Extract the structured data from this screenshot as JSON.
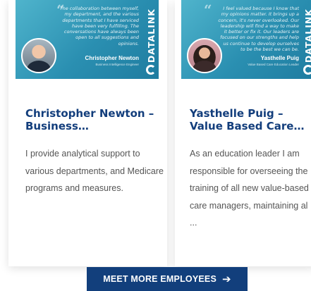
{
  "cards": [
    {
      "quote": "The collaboration between myself, my department, and the various departments that I have serviced have been very fulfilling. The conversations have always been open to all suggestions and opinions.",
      "signature_name": "Christopher Newton",
      "signature_title": "Business Intelligence Engineer",
      "brand": "DATALINK",
      "title": "Christopher Newton – Business…",
      "description": "I provide analytical support to various departments, and Medicare programs and measures."
    },
    {
      "quote": "I feel valued because I know that my opinions matter. It brings up a concern, it's never overlooked. Our leadership will find a way to make it better or fix it. Our leaders are focused on our strengths and help us continue to develop ourselves to be the best we can be.",
      "signature_name": "Yasthelle Puig",
      "signature_title": "Value Based Care Education Leader",
      "brand": "DATALINK",
      "title": "Yasthelle Puig – Value Based Care…",
      "description": "As an education leader I am responsible for overseeing the training of all new value-based care managers, maintaining al ..."
    }
  ],
  "cta": {
    "label": "MEET MORE EMPLOYEES",
    "icon": "arrow-right-icon"
  },
  "colors": {
    "accent": "#123f7c",
    "banner": "#2a8fb1",
    "text": "#555555"
  }
}
